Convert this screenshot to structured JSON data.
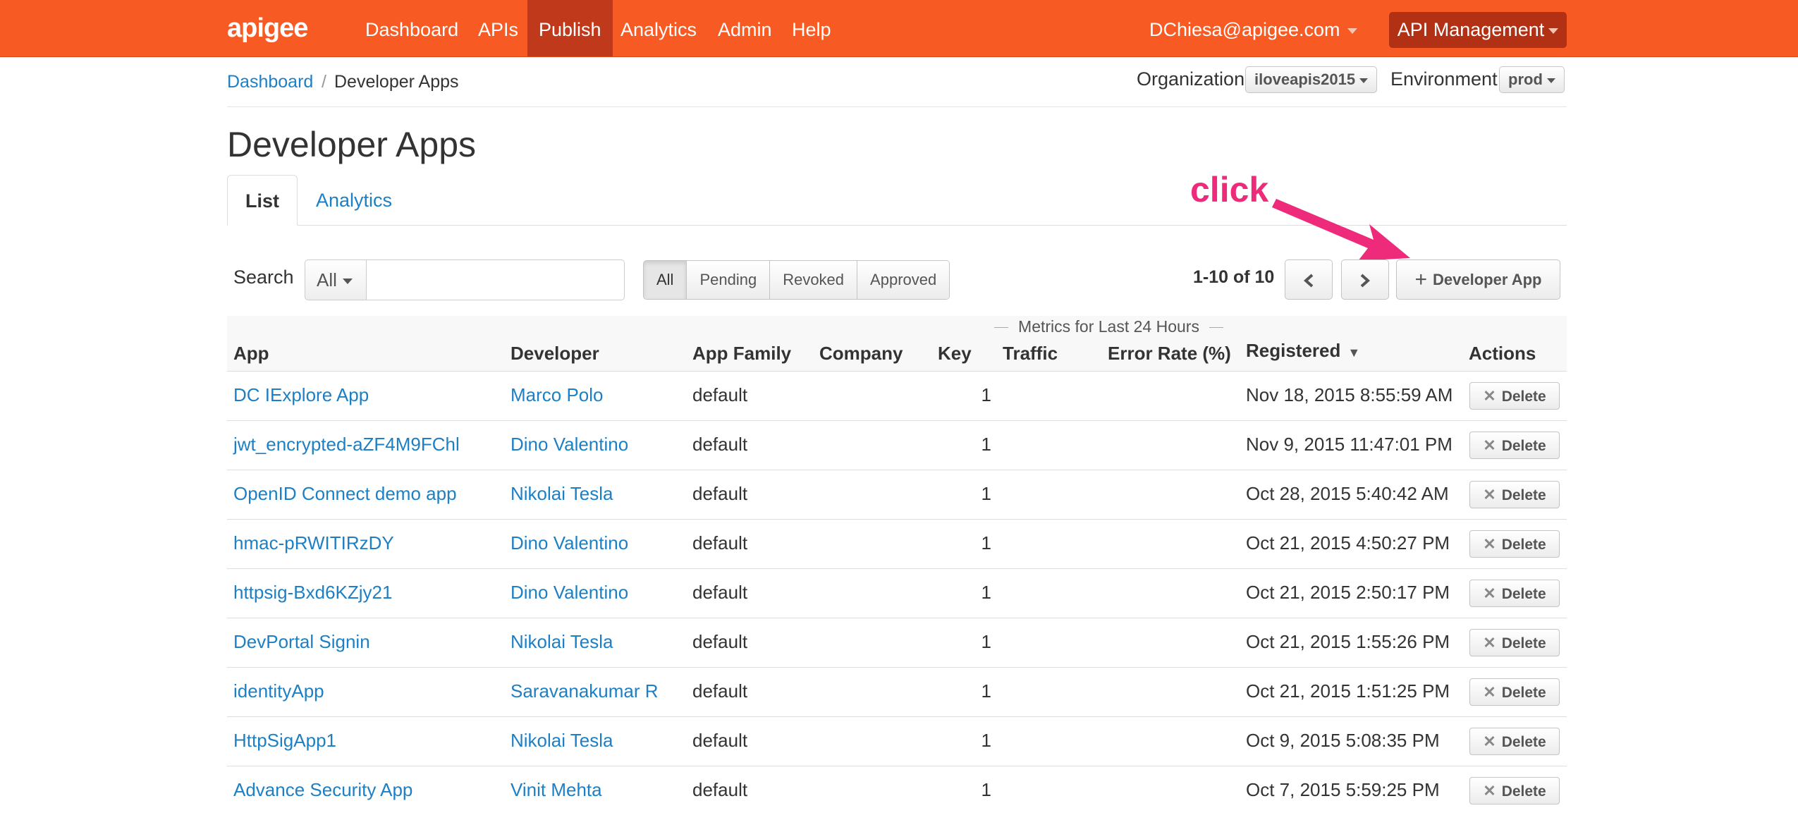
{
  "nav": {
    "logo": "apigee",
    "items": [
      {
        "label": "Dashboard"
      },
      {
        "label": "APIs"
      },
      {
        "label": "Publish"
      },
      {
        "label": "Analytics"
      },
      {
        "label": "Admin"
      },
      {
        "label": "Help"
      }
    ],
    "active": "Publish",
    "user": "DChiesa@apigee.com",
    "product_menu": "API Management",
    "color": "#f85a23"
  },
  "breadcrumb": {
    "root": "Dashboard",
    "separator": "/",
    "current": "Developer Apps"
  },
  "context": {
    "organization_label": "Organization",
    "organization_value": "iloveapis2015",
    "environment_label": "Environment",
    "environment_value": "prod"
  },
  "page": {
    "title": "Developer Apps",
    "tabs": [
      {
        "label": "List",
        "active": true
      },
      {
        "label": "Analytics",
        "active": false
      }
    ]
  },
  "annotation": {
    "text": "click",
    "color": "#ee2a7b"
  },
  "toolbar": {
    "search_label": "Search",
    "search_scope": "All",
    "search_value": "",
    "filters": [
      "All",
      "Pending",
      "Revoked",
      "Approved"
    ],
    "active_filter": "All",
    "page_count": "1-10 of 10",
    "prev_icon": "chevron-left-icon",
    "next_icon": "chevron-right-icon",
    "add_label": "Developer App",
    "add_icon": "plus-icon"
  },
  "table": {
    "metrics_caption": "Metrics for Last 24 Hours",
    "columns": [
      "App",
      "Developer",
      "App Family",
      "Company",
      "Key",
      "Traffic",
      "Error Rate (%)",
      "Registered",
      "Actions"
    ],
    "sort_indicator": "▼",
    "delete_label": "Delete",
    "rows": [
      {
        "app": "DC IExplore App",
        "developer": "Marco Polo",
        "family": "default",
        "company": "",
        "key": "1",
        "traffic": "",
        "error_rate": "",
        "registered": "Nov 18, 2015 8:55:59 AM"
      },
      {
        "app": "jwt_encrypted-aZF4M9FChl",
        "developer": "Dino Valentino",
        "family": "default",
        "company": "",
        "key": "1",
        "traffic": "",
        "error_rate": "",
        "registered": "Nov 9, 2015 11:47:01 PM"
      },
      {
        "app": "OpenID Connect demo app",
        "developer": "Nikolai Tesla",
        "family": "default",
        "company": "",
        "key": "1",
        "traffic": "",
        "error_rate": "",
        "registered": "Oct 28, 2015 5:40:42 AM"
      },
      {
        "app": "hmac-pRWITIRzDY",
        "developer": "Dino Valentino",
        "family": "default",
        "company": "",
        "key": "1",
        "traffic": "",
        "error_rate": "",
        "registered": "Oct 21, 2015 4:50:27 PM"
      },
      {
        "app": "httpsig-Bxd6KZjy21",
        "developer": "Dino Valentino",
        "family": "default",
        "company": "",
        "key": "1",
        "traffic": "",
        "error_rate": "",
        "registered": "Oct 21, 2015 2:50:17 PM"
      },
      {
        "app": "DevPortal Signin",
        "developer": "Nikolai Tesla",
        "family": "default",
        "company": "",
        "key": "1",
        "traffic": "",
        "error_rate": "",
        "registered": "Oct 21, 2015 1:55:26 PM"
      },
      {
        "app": "identityApp",
        "developer": "Saravanakumar R",
        "family": "default",
        "company": "",
        "key": "1",
        "traffic": "",
        "error_rate": "",
        "registered": "Oct 21, 2015 1:51:25 PM"
      },
      {
        "app": "HttpSigApp1",
        "developer": "Nikolai Tesla",
        "family": "default",
        "company": "",
        "key": "1",
        "traffic": "",
        "error_rate": "",
        "registered": "Oct 9, 2015 5:08:35 PM"
      },
      {
        "app": "Advance Security App",
        "developer": "Vinit Mehta",
        "family": "default",
        "company": "",
        "key": "1",
        "traffic": "",
        "error_rate": "",
        "registered": "Oct 7, 2015 5:59:25 PM"
      }
    ]
  }
}
